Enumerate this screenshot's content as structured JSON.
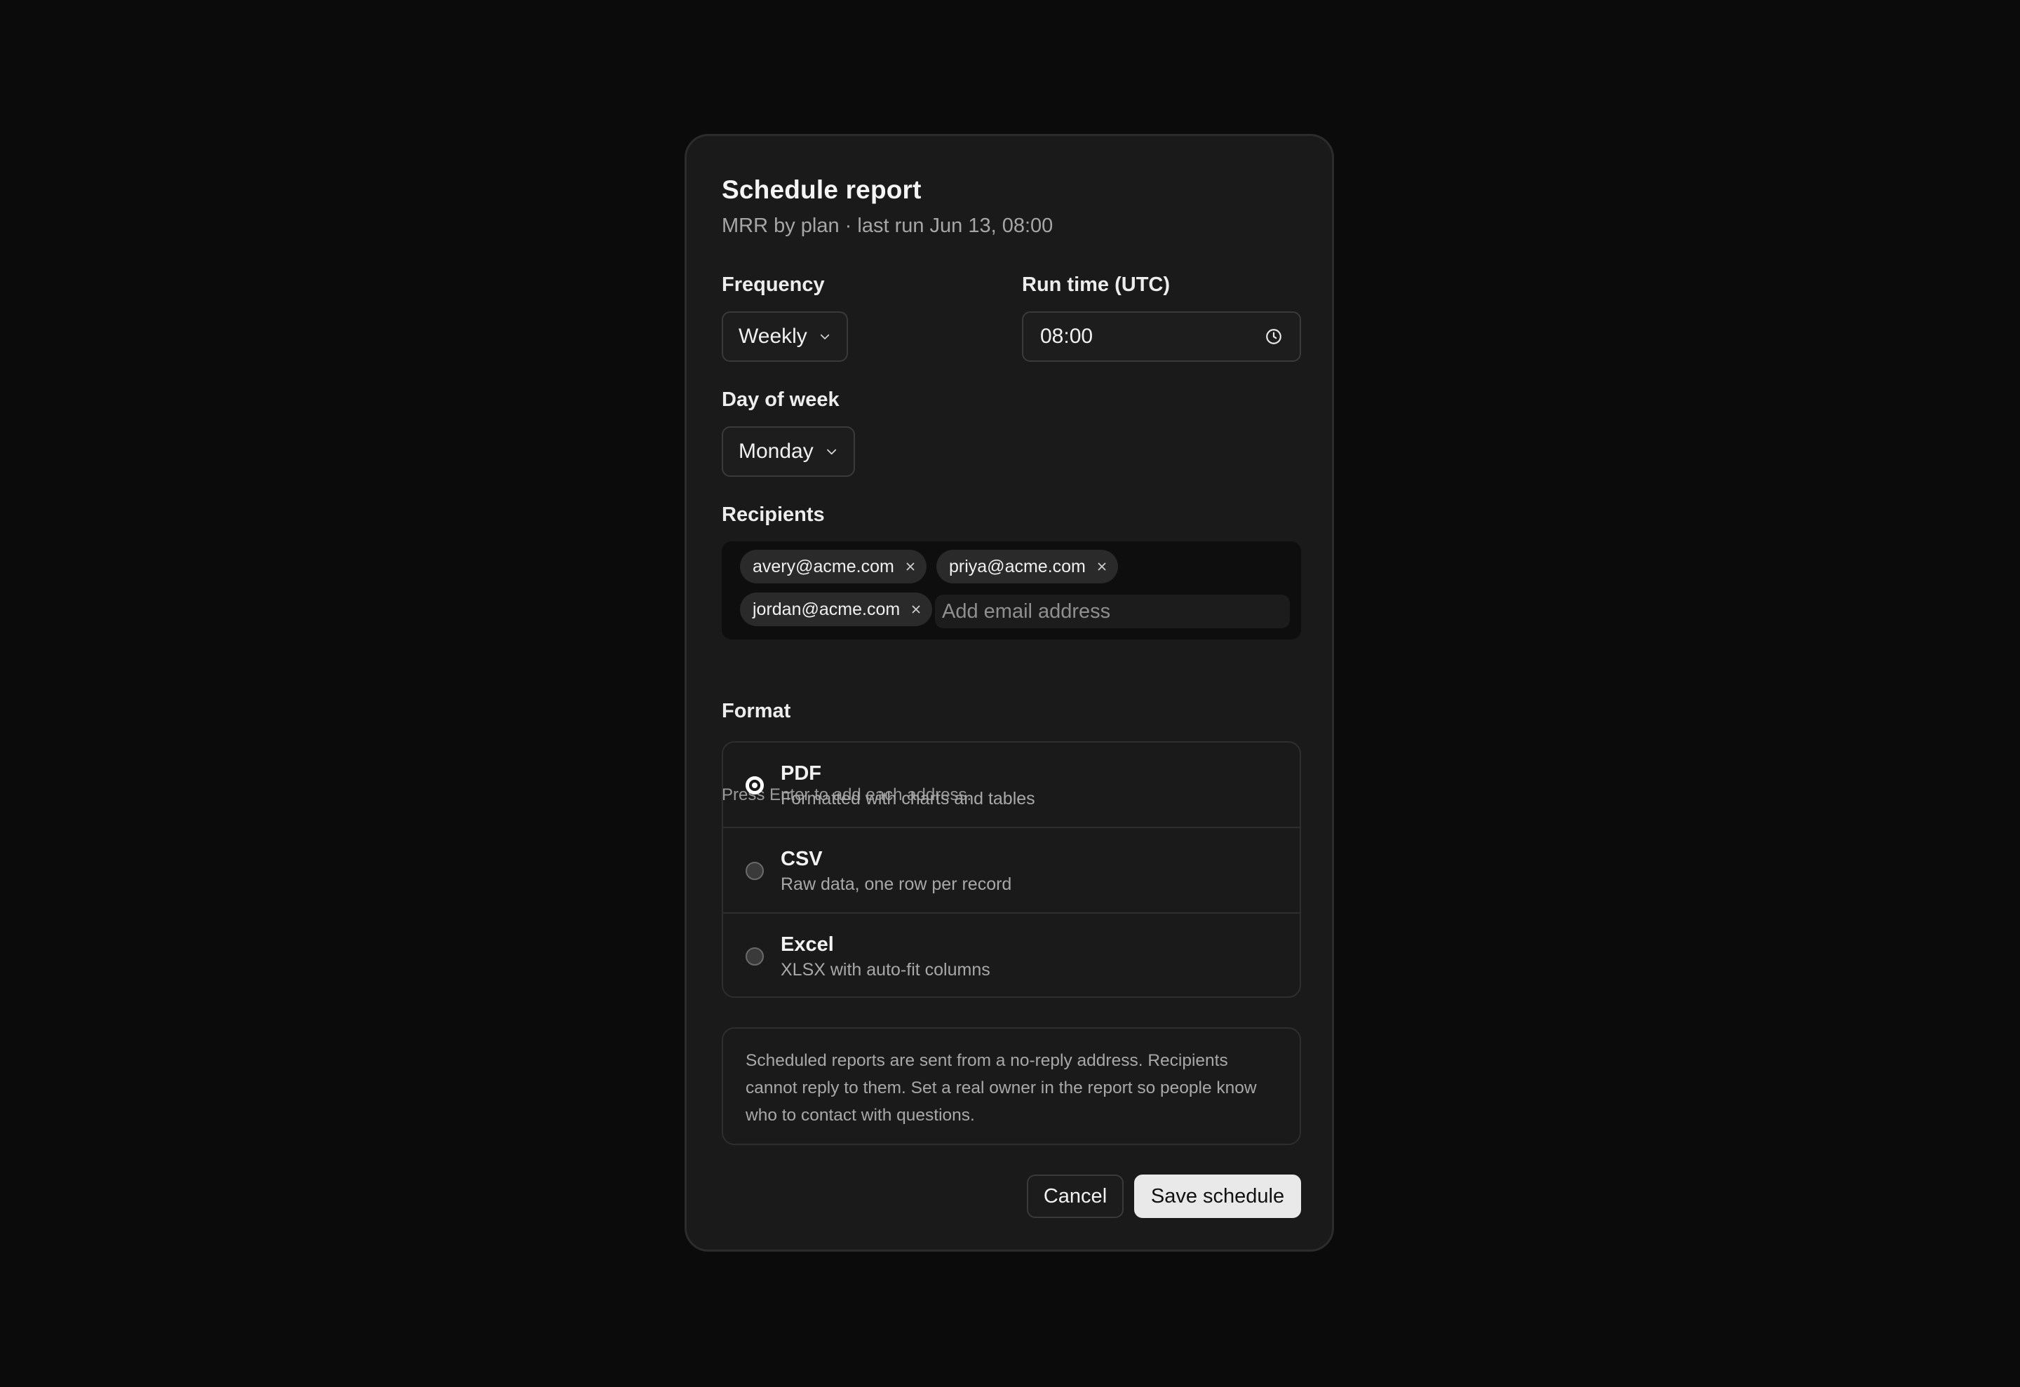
{
  "dialog": {
    "title": "Schedule report",
    "subtitle": "MRR by plan · last run Jun 13, 08:00"
  },
  "frequency": {
    "label": "Frequency",
    "value": "Weekly"
  },
  "run_time": {
    "label": "Run time (UTC)",
    "value": "08:00",
    "icon": "clock-icon"
  },
  "day_of_week": {
    "label": "Day of week",
    "value": "Monday"
  },
  "recipients": {
    "label": "Recipients",
    "chips": [
      "avery@acme.com",
      "priya@acme.com",
      "jordan@acme.com"
    ],
    "input_placeholder": "Add email address",
    "hint": "Press Enter to add each address."
  },
  "format": {
    "label": "Format",
    "selected": "PDF",
    "options": [
      {
        "name": "PDF",
        "description": "Formatted with charts and tables"
      },
      {
        "name": "CSV",
        "description": "Raw data, one row per record"
      },
      {
        "name": "Excel",
        "description": "XLSX with auto-fit columns"
      }
    ]
  },
  "notice": "Scheduled reports are sent from a no-reply address. Recipients cannot reply to them. Set a real owner in the report so people know who to contact with questions.",
  "actions": {
    "cancel_label": "Cancel",
    "save_label": "Save schedule"
  },
  "colors": {
    "background": "#0b0b0b",
    "surface": "#1a1a1a",
    "primary_button": "#e9e9e9"
  }
}
